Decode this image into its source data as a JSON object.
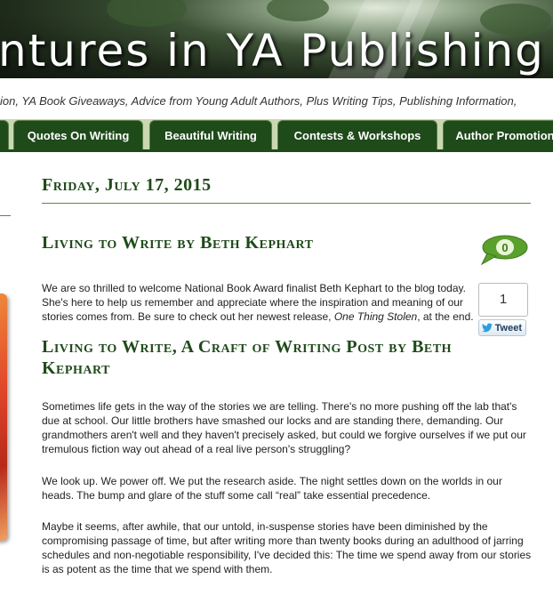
{
  "banner": {
    "title": "ntures in YA Publishing"
  },
  "tagline": "ion, YA Book Giveaways, Advice from Young Adult Authors, Plus Writing Tips, Publishing Information,",
  "nav": {
    "tabs": [
      "Quotes On Writing",
      "Beautiful Writing",
      "Contests & Workshops",
      "Author Promotion"
    ]
  },
  "post": {
    "date": "Friday, July 17, 2015",
    "title": "Living to Write by Beth Kephart",
    "comment_count": "0",
    "tweet_count": "1",
    "tweet_label": "Tweet",
    "intro_before": "We are so thrilled to welcome National Book Award finalist Beth Kephart to the blog today. She's here to help us remember and appreciate where the inspiration and meaning of our stories comes from. Be sure to check out her newest release, ",
    "intro_book": "One Thing Stolen",
    "intro_after": ", at the end.",
    "heading": "Living to Write, A Craft of Writing Post by Beth Kephart",
    "paragraphs": [
      "Sometimes life gets in the way of the stories we are telling. There's no more pushing off the lab that's due at school. Our little brothers have smashed our locks and are standing there, demanding. Our grandmothers aren't well and they haven't precisely asked, but could we forgive ourselves if we put our tremulous fiction way out ahead of a real live person's struggling?",
      "We look up. We power off. We put the research aside. The night settles down on the worlds in our heads. The bump and glare of the stuff some call “real” take essential precedence.",
      "Maybe it seems, after awhile, that our untold, in-suspense stories have been diminished by the compromising passage of time, but after writing more than twenty books during an adulthood of jarring schedules and non-negotiable responsibility, I've decided this: The time we spend away from our stories is as potent as the time that we spend with them."
    ]
  },
  "colors": {
    "accent": "#1f4a1a",
    "nav_bg": "#c9d8b2",
    "rule": "#5b8a3a",
    "bubble": "#5aa02c"
  }
}
